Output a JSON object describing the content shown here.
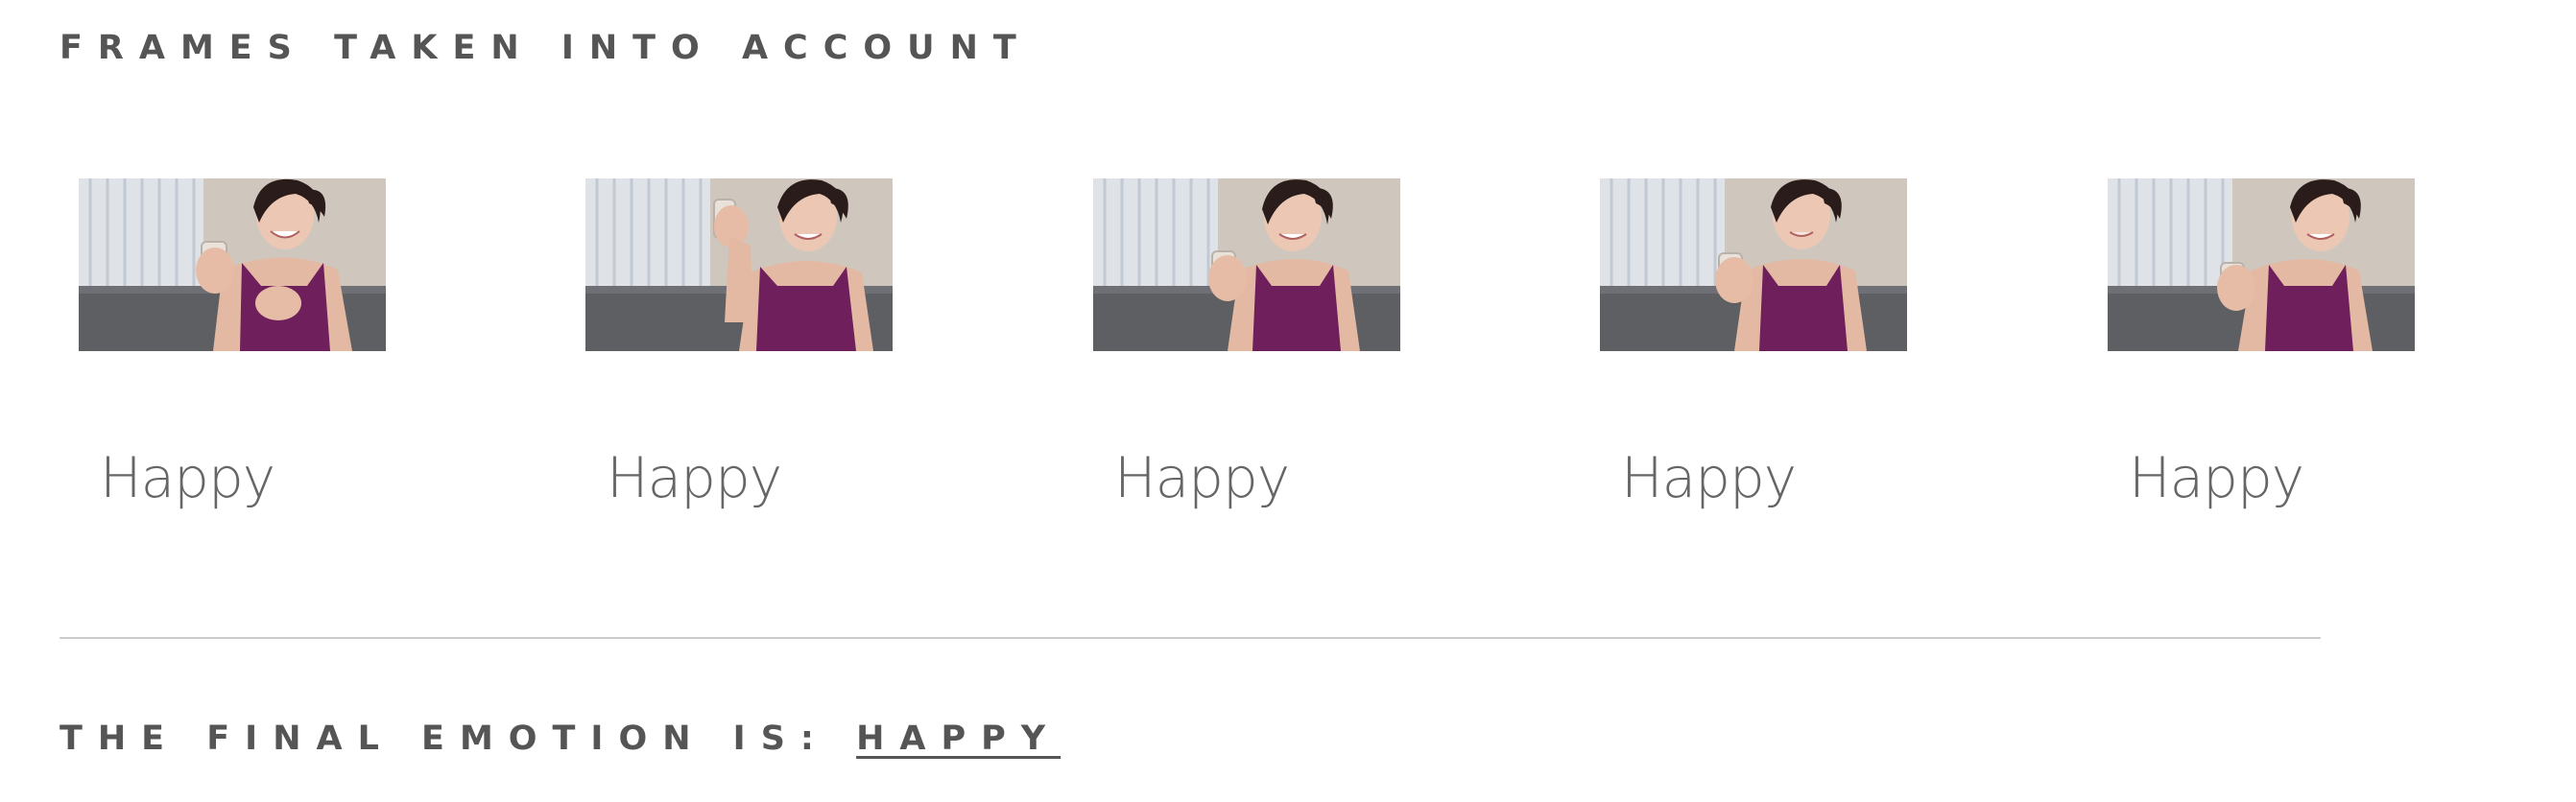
{
  "frames_section": {
    "heading": "FRAMES TAKEN INTO ACCOUNT"
  },
  "frames": [
    {
      "label": "Happy"
    },
    {
      "label": "Happy"
    },
    {
      "label": "Happy"
    },
    {
      "label": "Happy"
    },
    {
      "label": "Happy"
    }
  ],
  "result": {
    "prefix": "THE FINAL EMOTION IS: ",
    "emotion": "HAPPY"
  },
  "colors": {
    "text": "#555555",
    "divider": "#cccccc"
  }
}
